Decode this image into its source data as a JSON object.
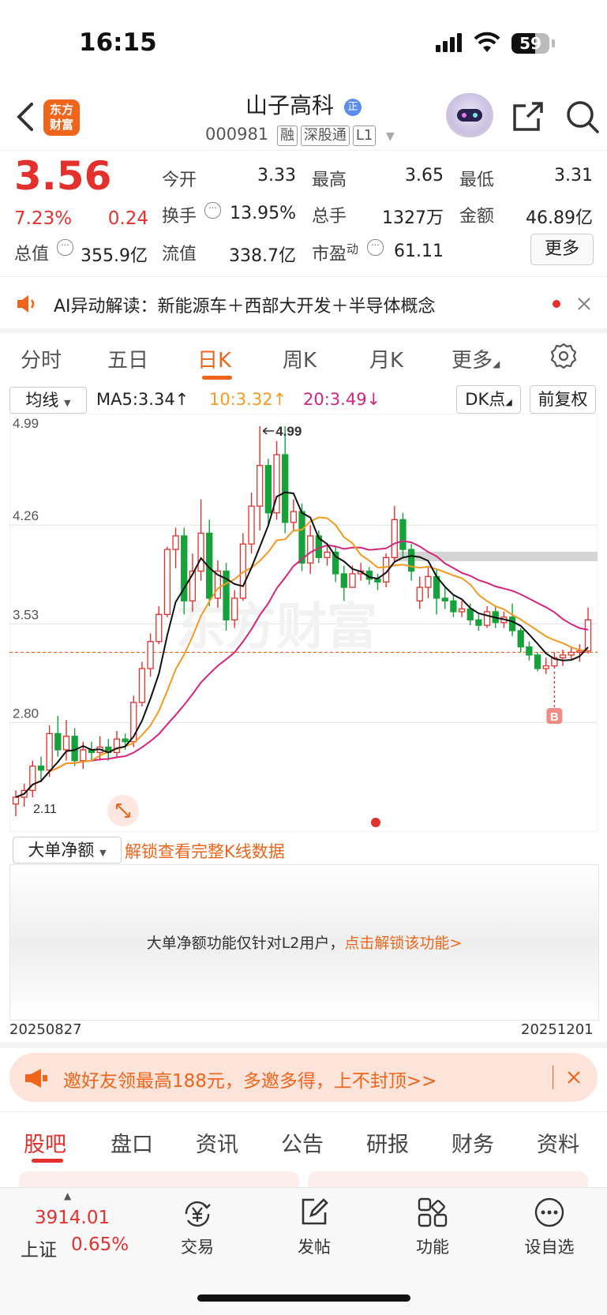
{
  "status_bar": {
    "time": "16:15",
    "battery": "59"
  },
  "header": {
    "stock_name": "山子高科",
    "badge": "正",
    "code": "000981",
    "tags": [
      "融",
      "深股通",
      "L1"
    ],
    "logo_text": [
      "东方",
      "财富"
    ]
  },
  "quote": {
    "price": "3.56",
    "change_pct": "7.23%",
    "change": "0.24",
    "rows": [
      [
        {
          "label": "今开",
          "value": "3.33",
          "color": "red"
        },
        {
          "label": "最高",
          "value": "3.65",
          "color": "red"
        },
        {
          "label": "最低",
          "value": "3.31",
          "color": "green"
        }
      ],
      [
        {
          "label": "换手",
          "value": "13.95%",
          "color": "black"
        },
        {
          "label": "总手",
          "value": "1327万",
          "color": "black"
        },
        {
          "label": "金额",
          "value": "46.89亿",
          "color": "black"
        }
      ],
      [
        {
          "label": "总值",
          "value": "355.9亿",
          "color": "black"
        },
        {
          "label": "流值",
          "value": "338.7亿",
          "color": "black"
        },
        {
          "label": "市盈",
          "sup": "动",
          "value": "61.11",
          "color": "black"
        }
      ]
    ],
    "more_label": "更多"
  },
  "ai_banner": {
    "text": "AI异动解读：新能源车＋西部大开发＋半导体概念"
  },
  "period_tabs": {
    "items": [
      "分时",
      "五日",
      "日K",
      "周K",
      "月K",
      "更多"
    ],
    "active": "日K"
  },
  "chart_controls": {
    "indicator_select": "均线",
    "ma5": "MA5:3.34↑",
    "ma10": "10:3.32↑",
    "ma20": "20:3.49↓",
    "dk_button": "DK点",
    "fq_button": "前复权"
  },
  "colors": {
    "up": "#e5312e",
    "down": "#16a23a",
    "ma5": "#111111",
    "ma10": "#f59a23",
    "ma20": "#d6257f",
    "accent": "#f0651c"
  },
  "chart_data": {
    "type": "candlestick",
    "y_ticks": [
      "4.99",
      "4.26",
      "3.53",
      "2.80"
    ],
    "ylim": [
      2.11,
      4.99
    ],
    "max_label": "4.99",
    "min_label": "2.11",
    "current_price_line": 3.32,
    "signal_marker": "B",
    "x_start": "20250827",
    "x_end": "20251201",
    "candles": [
      [
        2.2,
        2.25,
        2.11,
        2.3
      ],
      [
        2.25,
        2.3,
        2.18,
        2.35
      ],
      [
        2.3,
        2.48,
        2.25,
        2.52
      ],
      [
        2.48,
        2.45,
        2.36,
        2.55
      ],
      [
        2.45,
        2.72,
        2.4,
        2.78
      ],
      [
        2.72,
        2.6,
        2.55,
        2.85
      ],
      [
        2.6,
        2.7,
        2.52,
        2.82
      ],
      [
        2.7,
        2.52,
        2.48,
        2.76
      ],
      [
        2.52,
        2.6,
        2.46,
        2.66
      ],
      [
        2.6,
        2.58,
        2.52,
        2.66
      ],
      [
        2.58,
        2.62,
        2.52,
        2.7
      ],
      [
        2.62,
        2.58,
        2.52,
        2.68
      ],
      [
        2.58,
        2.68,
        2.54,
        2.74
      ],
      [
        2.68,
        2.66,
        2.6,
        2.72
      ],
      [
        2.66,
        2.95,
        2.62,
        3.0
      ],
      [
        2.95,
        3.2,
        2.92,
        3.25
      ],
      [
        3.2,
        3.4,
        3.14,
        3.46
      ],
      [
        3.4,
        3.6,
        3.38,
        3.66
      ],
      [
        3.6,
        4.08,
        3.58,
        4.1
      ],
      [
        4.08,
        4.18,
        3.94,
        4.24
      ],
      [
        4.18,
        3.7,
        3.6,
        4.24
      ],
      [
        3.7,
        3.92,
        3.62,
        4.05
      ],
      [
        3.92,
        4.2,
        3.85,
        4.45
      ],
      [
        4.2,
        3.72,
        3.66,
        4.3
      ],
      [
        3.72,
        3.92,
        3.65,
        4.0
      ],
      [
        3.92,
        3.56,
        3.48,
        3.98
      ],
      [
        3.56,
        3.72,
        3.5,
        3.78
      ],
      [
        3.72,
        4.12,
        3.7,
        4.2
      ],
      [
        4.12,
        4.4,
        4.05,
        4.5
      ],
      [
        4.4,
        4.7,
        4.22,
        4.99
      ],
      [
        4.7,
        4.35,
        4.25,
        4.75
      ],
      [
        4.35,
        4.78,
        4.3,
        4.88
      ],
      [
        4.78,
        4.28,
        4.2,
        4.99
      ],
      [
        4.28,
        4.36,
        4.22,
        4.45
      ],
      [
        4.36,
        3.98,
        3.92,
        4.42
      ],
      [
        3.98,
        4.18,
        3.9,
        4.26
      ],
      [
        4.18,
        4.02,
        3.98,
        4.22
      ],
      [
        4.02,
        4.06,
        3.96,
        4.12
      ],
      [
        4.06,
        3.9,
        3.84,
        4.1
      ],
      [
        3.9,
        3.8,
        3.7,
        3.96
      ],
      [
        3.8,
        3.9,
        3.82,
        3.96
      ],
      [
        3.9,
        3.92,
        3.85,
        3.98
      ],
      [
        3.92,
        3.86,
        3.82,
        3.95
      ],
      [
        3.86,
        3.84,
        3.78,
        3.9
      ],
      [
        3.84,
        4.02,
        3.8,
        4.05
      ],
      [
        4.02,
        4.3,
        3.98,
        4.4
      ],
      [
        4.3,
        4.08,
        4.02,
        4.35
      ],
      [
        4.08,
        3.92,
        3.85,
        4.12
      ],
      [
        3.7,
        3.8,
        3.64,
        3.88
      ],
      [
        3.8,
        3.88,
        3.72,
        3.96
      ],
      [
        3.88,
        3.72,
        3.6,
        3.94
      ],
      [
        3.72,
        3.7,
        3.64,
        3.8
      ],
      [
        3.7,
        3.62,
        3.58,
        3.74
      ],
      [
        3.62,
        3.64,
        3.58,
        3.7
      ],
      [
        3.64,
        3.56,
        3.52,
        3.68
      ],
      [
        3.56,
        3.52,
        3.48,
        3.6
      ],
      [
        3.52,
        3.62,
        3.5,
        3.66
      ],
      [
        3.62,
        3.54,
        3.5,
        3.66
      ],
      [
        3.54,
        3.58,
        3.5,
        3.62
      ],
      [
        3.58,
        3.48,
        3.44,
        3.68
      ],
      [
        3.48,
        3.36,
        3.32,
        3.5
      ],
      [
        3.36,
        3.3,
        3.26,
        3.4
      ],
      [
        3.3,
        3.2,
        3.18,
        3.32
      ],
      [
        3.2,
        3.22,
        3.16,
        3.28
      ],
      [
        3.22,
        3.28,
        3.2,
        3.32
      ],
      [
        3.28,
        3.3,
        3.22,
        3.34
      ],
      [
        3.3,
        3.32,
        3.26,
        3.36
      ],
      [
        3.32,
        3.33,
        3.25,
        3.38
      ],
      [
        3.33,
        3.56,
        3.31,
        3.65
      ]
    ]
  },
  "big_order": {
    "select_label": "大单净额",
    "unlock_link": "解锁查看完整K线数据",
    "notice": "大单净额功能仅针对L2用户，",
    "notice_link": "点击解锁该功能>"
  },
  "promo": {
    "text": "邀好友领最高188元，多邀多得，上不封顶>>"
  },
  "bottom_tabs": {
    "items": [
      "股吧",
      "盘口",
      "资讯",
      "公告",
      "研报",
      "财务",
      "资料"
    ],
    "active": "股吧"
  },
  "bottom_nav": {
    "index_value": "3914.01",
    "index_name": "上证",
    "index_change": "0.65%",
    "items": [
      "交易",
      "发帖",
      "功能",
      "设自选"
    ]
  }
}
